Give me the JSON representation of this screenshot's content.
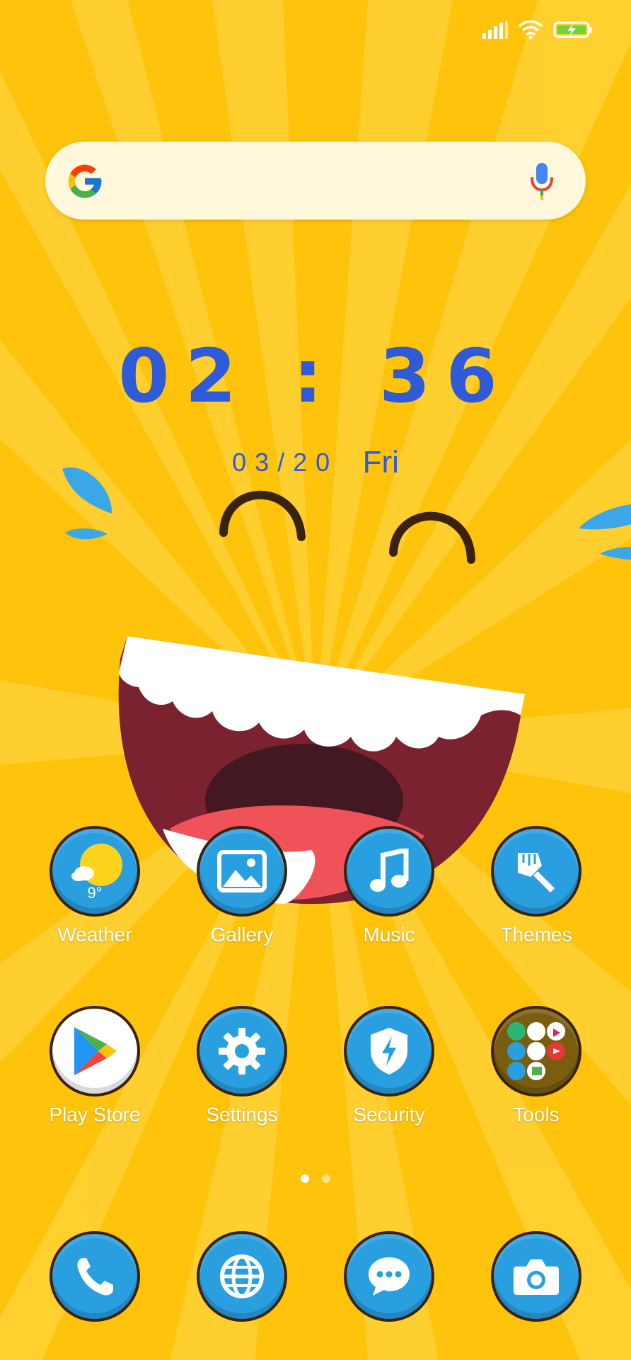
{
  "status_bar": {
    "icons": [
      "signal-icon",
      "wifi-icon",
      "battery-charging-icon"
    ]
  },
  "search_bar": {
    "icons": [
      "google-logo-icon",
      "microphone-icon"
    ]
  },
  "clock": {
    "time": "02 : 36",
    "date": "03/20",
    "weekday": "Fri"
  },
  "apps_row1": [
    {
      "label": "Weather",
      "icon": "weather-icon",
      "temp": "9°"
    },
    {
      "label": "Gallery",
      "icon": "gallery-icon"
    },
    {
      "label": "Music",
      "icon": "music-icon"
    },
    {
      "label": "Themes",
      "icon": "themes-brush-icon"
    }
  ],
  "apps_row2": [
    {
      "label": "Play Store",
      "icon": "play-store-icon"
    },
    {
      "label": "Settings",
      "icon": "gear-icon"
    },
    {
      "label": "Security",
      "icon": "shield-icon"
    },
    {
      "label": "Tools",
      "icon": "folder-icon"
    }
  ],
  "dock": [
    {
      "icon": "phone-icon"
    },
    {
      "icon": "browser-globe-icon"
    },
    {
      "icon": "messages-icon"
    },
    {
      "icon": "camera-icon"
    }
  ],
  "page_indicator": {
    "pages": 2,
    "current": 1
  },
  "colors": {
    "background": "#FFC30B",
    "clock": "#2F5BD9",
    "icon_blue": "#2A9FE0",
    "mouth": "#7A2230"
  }
}
